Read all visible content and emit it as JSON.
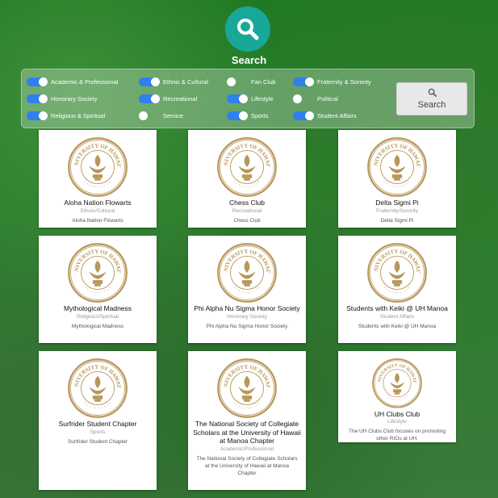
{
  "header": {
    "title": "Search",
    "search_icon": "magnifier-icon"
  },
  "filters": [
    {
      "label": "Academic & Professional",
      "on": true
    },
    {
      "label": "Ethnic & Cultural",
      "on": true
    },
    {
      "label": "Fan Club",
      "on": false
    },
    {
      "label": "Fraternity & Sorority",
      "on": true
    },
    {
      "label": "Honorary Society",
      "on": true
    },
    {
      "label": "Recreational",
      "on": true
    },
    {
      "label": "Lifestyle",
      "on": true
    },
    {
      "label": "Political",
      "on": false
    },
    {
      "label": "Religious & Spiritual",
      "on": true
    },
    {
      "label": "Service",
      "on": false
    },
    {
      "label": "Sports",
      "on": true
    },
    {
      "label": "Student Affairs",
      "on": true
    }
  ],
  "search_button": {
    "label": "Search",
    "icon": "search-icon"
  },
  "seal_text": "UNIVERSITY OF HAWAI'I",
  "clubs": [
    {
      "name": "Aloha Nation Flowarts",
      "category": "Ethnic/Cultural",
      "description": "Aloha Nation Flowarts"
    },
    {
      "name": "Chess Club",
      "category": "Recreational",
      "description": "Chess Club"
    },
    {
      "name": "Delta Sigmi Pi",
      "category": "Fraternity/Sorority",
      "description": "Delta Sigmi Pi"
    },
    {
      "name": "Mythological Madness",
      "category": "Religious/Spiritual",
      "description": "Mythological Madness"
    },
    {
      "name": "Phi Alpha Nu Sigma Honor Society",
      "category": "Honorary Society",
      "description": "Phi Alpha Nu Sigma Honor Society"
    },
    {
      "name": "Students with Keiki @ UH Manoa",
      "category": "Student Affairs",
      "description": "Students with Keiki @ UH Manoa"
    },
    {
      "name": "Surfrider Student Chapter",
      "category": "Sports",
      "description": "Surfrider Student Chapter"
    },
    {
      "name": "The National Society of Collegiate Scholars at the University of Hawaii at Manoa Chapter",
      "category": "Academic/Professional",
      "description": "The National Society of Collegiate Scholars at the University of Hawaii at Manoa Chapter"
    },
    {
      "name": "UH Clubs Club",
      "category": "Lifestyle",
      "description": "The UH Clubs Club focuses on promoting other RIOs at UH."
    }
  ],
  "colors": {
    "accent": "#17a89a",
    "toggle_on": "#2f80ed",
    "seal_gold": "#b8975a"
  }
}
